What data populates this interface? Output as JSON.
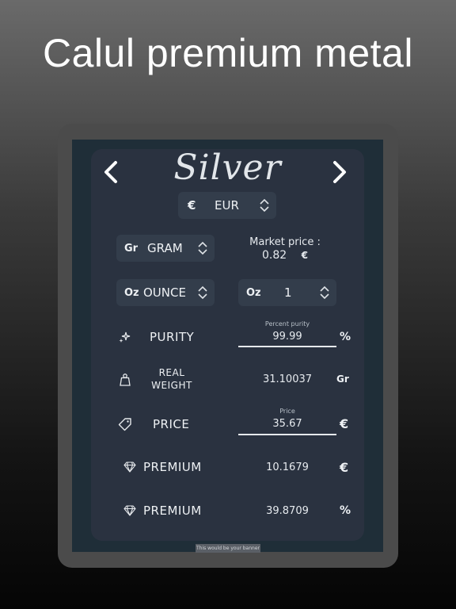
{
  "headline": "Calul premium metal",
  "app": {
    "title": "Silver",
    "currency": {
      "symbol": "€",
      "code": "EUR"
    },
    "weight_unit": {
      "abbr": "Gr",
      "label": "GRAM"
    },
    "market_price": {
      "label": "Market price :",
      "value": "0.82",
      "symbol": "€"
    },
    "quantity_unit": {
      "abbr": "Oz",
      "label": "OUNCE"
    },
    "quantity": {
      "abbr": "Oz",
      "value": "1"
    },
    "purity": {
      "label": "PURITY",
      "hint": "Percent purity",
      "value": "99.99",
      "unit": "%"
    },
    "real_weight": {
      "label_line1": "REAL",
      "label_line2": "WEIGHT",
      "value": "31.10037",
      "unit": "Gr"
    },
    "price": {
      "label": "PRICE",
      "hint": "Price",
      "value": "35.67",
      "unit": "€"
    },
    "premium_amount": {
      "label": "PREMIUM",
      "value": "10.1679",
      "unit": "€"
    },
    "premium_percent": {
      "label": "PREMIUM",
      "value": "39.8709",
      "unit": "%"
    }
  },
  "banner": {
    "text": "This would be your banner"
  }
}
